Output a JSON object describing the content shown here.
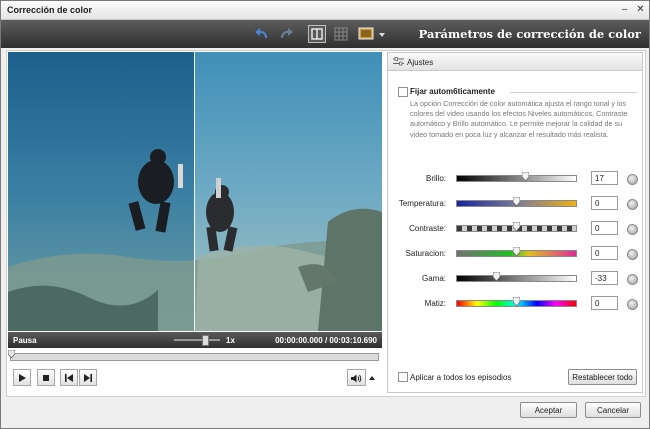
{
  "window": {
    "title": "Corrección de color",
    "controls": [
      "minimize-icon",
      "close-icon"
    ]
  },
  "toolbar": {
    "heading": "Parámetros de corrección de color",
    "icons": [
      "undo-icon",
      "redo-icon",
      "split-view-icon",
      "grid-view-icon",
      "display-mode-icon",
      "dropdown-arrow-icon"
    ]
  },
  "player": {
    "status": "Pausa",
    "speed": "1x",
    "current_time": "00:00:00.000",
    "separator": "/",
    "total_time": "00:03:10.690",
    "seek_position_fraction": 0.0,
    "controls": [
      "play-icon",
      "stop-icon",
      "previous-icon",
      "next-icon",
      "volume-icon",
      "volume-dropdown-icon"
    ]
  },
  "panel": {
    "tab": "Ajustes",
    "auto": {
      "label": "Fijar autom6ticamente",
      "checked": false,
      "description": "La opción Corrección de color automática ajusta el rango tonal y los colores del video usando los efectos Niveles automáticos, Contraste automático y Brillo automático. Le permite mejorar la calidad de su video tomado en poca luz y alcanzar el resultado más realista."
    },
    "sliders": [
      {
        "label": "Brillo:",
        "value": "17",
        "fraction": 0.58,
        "gradient": [
          "#000000",
          "#ffffff"
        ]
      },
      {
        "label": "Temperatura:",
        "value": "0",
        "fraction": 0.5,
        "gradient": [
          "#1d2fae",
          "#f0b010"
        ]
      },
      {
        "label": "Contraste:",
        "value": "0",
        "fraction": 0.5,
        "gradient": [
          "#555555",
          "#e0e0e0"
        ]
      },
      {
        "label": "Saturacion:",
        "value": "0",
        "fraction": 0.5,
        "gradient": [
          "#707070",
          "#e12b96"
        ]
      },
      {
        "label": "Gama:",
        "value": "-33",
        "fraction": 0.34,
        "gradient": [
          "#000000",
          "#ffffff"
        ]
      },
      {
        "label": "Matiz:",
        "value": "0",
        "fraction": 0.5,
        "gradient": [
          "#ff0000",
          "#ff00ff"
        ]
      }
    ],
    "apply_all": {
      "label": "Aplicar a todos los episodios",
      "checked": false
    },
    "reset_all": "Restablecer todo"
  },
  "footer": {
    "accept": "Aceptar",
    "cancel": "Cancelar"
  },
  "colors": {
    "toolbar": "#3a3a3a",
    "window": "#efefef",
    "water": "#2b6a95"
  }
}
